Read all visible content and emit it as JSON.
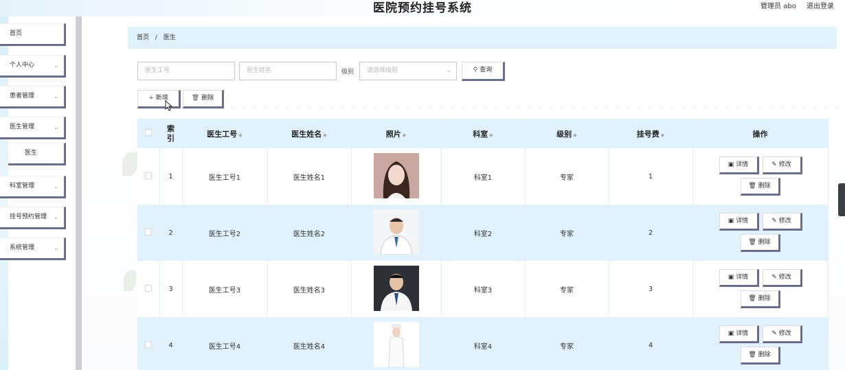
{
  "header": {
    "title": "医院预约挂号系统",
    "user_label": "管理员 abo",
    "logout_label": "退出登录"
  },
  "sidebar": {
    "items": [
      {
        "label": "首页"
      },
      {
        "label": "个人中心"
      },
      {
        "label": "患者管理"
      },
      {
        "label": "医生管理"
      },
      {
        "label": "医生"
      },
      {
        "label": "科室管理"
      },
      {
        "label": "挂号预约管理"
      },
      {
        "label": "系统管理"
      }
    ]
  },
  "breadcrumb": {
    "home": "首页",
    "separator": "/",
    "current": "医生"
  },
  "search": {
    "doctor_id_placeholder": "医生工号",
    "doctor_name_placeholder": "医生姓名",
    "level_label": "级别",
    "level_placeholder": "请选择级别",
    "query_button": "查询"
  },
  "actions": {
    "add_button": "新增",
    "delete_button": "删除"
  },
  "table": {
    "columns": [
      "索引",
      "医生工号",
      "医生姓名",
      "照片",
      "科室",
      "级别",
      "挂号费",
      "操作"
    ],
    "rows": [
      {
        "index": "1",
        "doctor_id": "医生工号1",
        "doctor_name": "医生姓名1",
        "department": "科室1",
        "level": "专家",
        "fee": "1"
      },
      {
        "index": "2",
        "doctor_id": "医生工号2",
        "doctor_name": "医生姓名2",
        "department": "科室2",
        "level": "专家",
        "fee": "2"
      },
      {
        "index": "3",
        "doctor_id": "医生工号3",
        "doctor_name": "医生姓名3",
        "department": "科室3",
        "level": "专家",
        "fee": "3"
      },
      {
        "index": "4",
        "doctor_id": "医生工号4",
        "doctor_name": "医生姓名4",
        "department": "科室4",
        "level": "专家",
        "fee": "4"
      }
    ],
    "row_actions": {
      "detail": "详情",
      "edit": "修改",
      "delete": "删除"
    }
  },
  "colors": {
    "header_bg": "#dff2fd",
    "button_border": "#6b6b8a"
  }
}
